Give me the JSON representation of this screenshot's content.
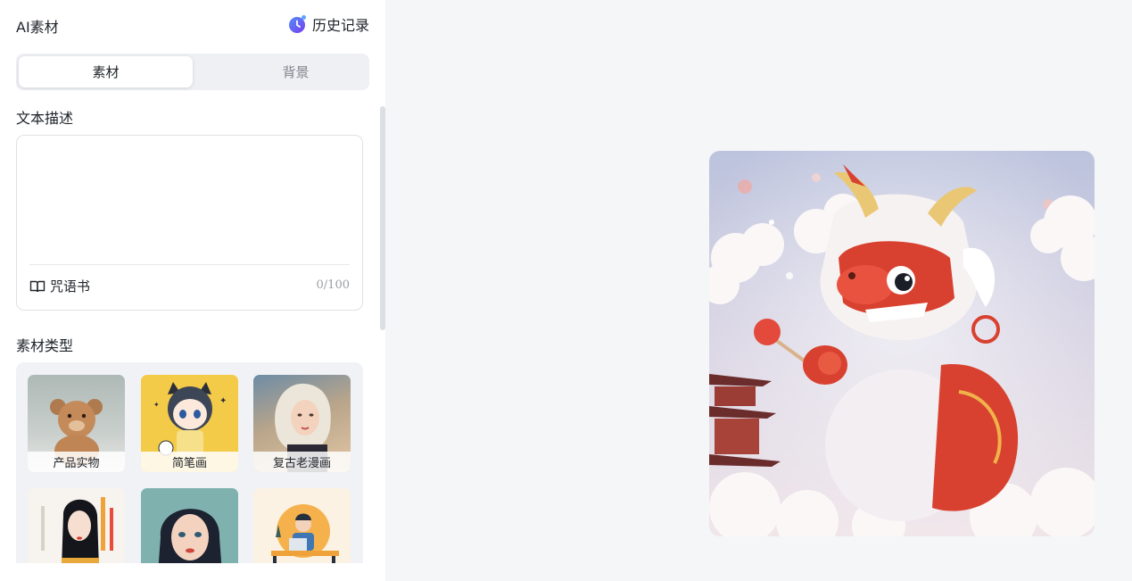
{
  "header": {
    "title": "AI素材",
    "history_label": "历史记录"
  },
  "tabs": [
    {
      "label": "素材",
      "active": true
    },
    {
      "label": "背景",
      "active": false
    }
  ],
  "description": {
    "label": "文本描述",
    "value": "",
    "spellbook_label": "咒语书",
    "counter": "0/100"
  },
  "material_types": {
    "label": "素材类型",
    "items": [
      {
        "label": "产品实物"
      },
      {
        "label": "简笔画"
      },
      {
        "label": "复古老漫画"
      },
      {
        "label": ""
      },
      {
        "label": ""
      },
      {
        "label": ""
      }
    ]
  },
  "colors": {
    "accent_purple": "#6c4bf0",
    "accent_blue": "#3b7cf6",
    "dragon_red": "#d8412f"
  },
  "icons": [
    "history-icon",
    "book-icon"
  ]
}
